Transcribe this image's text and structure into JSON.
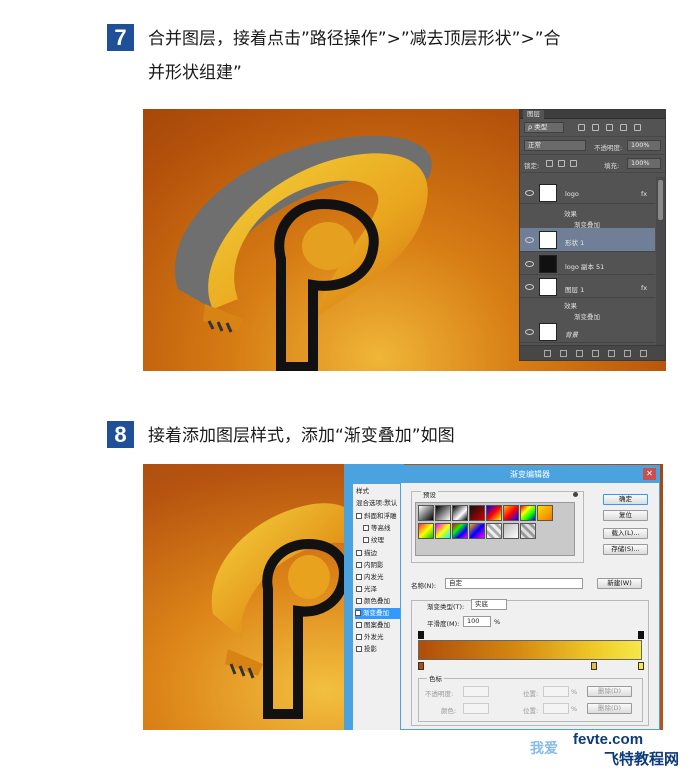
{
  "step7": {
    "number": "7",
    "line1": "合并图层，接着点击”路径操作”>”减去顶层形状”>”合",
    "line2": "并形状组建”"
  },
  "step8": {
    "number": "8",
    "text": "接着添加图层样式，添加“渐变叠加”如图"
  },
  "layers_panel": {
    "tab": "图层",
    "kind": "ρ 类型",
    "blend_mode": "正常",
    "opacity_label": "不透明度:",
    "opacity": "100%",
    "lock_label": "锁定:",
    "fill_label": "填充:",
    "fill": "100%",
    "layers": [
      {
        "name": "logo",
        "fx": "fx"
      },
      {
        "name": "效果"
      },
      {
        "name": "渐变叠加"
      },
      {
        "name": "形状 1"
      },
      {
        "name": "logo 副本 51"
      },
      {
        "name": "图层 1",
        "fx": "fx"
      },
      {
        "name": "效果"
      },
      {
        "name": "渐变叠加"
      },
      {
        "name": "背景"
      }
    ]
  },
  "layer_style": {
    "items": [
      "样式",
      "混合选项:默认",
      "斜面和浮雕",
      "等高线",
      "纹理",
      "描边",
      "内阴影",
      "内发光",
      "光泽",
      "颜色叠加",
      "渐变叠加",
      "图案叠加",
      "外发光",
      "投影"
    ],
    "selected": "渐变叠加"
  },
  "gradient_editor": {
    "title": "渐变编辑器",
    "presets_label": "预设",
    "buttons": {
      "ok": "确定",
      "reset": "复位",
      "load": "载入(L)...",
      "save": "存储(S)...",
      "new": "新建(W)"
    },
    "name_label": "名称(N):",
    "name_value": "自定",
    "type_label": "渐变类型(T):",
    "type_value": "实底",
    "smooth_label": "平滑度(M):",
    "smooth_value": "100",
    "smooth_unit": "%",
    "stops_label": "色标",
    "opacity_label": "不透明度:",
    "location_label": "位置:",
    "color_label": "颜色:",
    "percent": "%",
    "delete_label": "删除(D)",
    "colors": {
      "start": "#b04d0a",
      "mid": "#d58a12",
      "end": "#f5e84a"
    }
  },
  "watermark": {
    "site": "fevte.com",
    "brand": "飞特教程网",
    "cn": "我爱"
  }
}
